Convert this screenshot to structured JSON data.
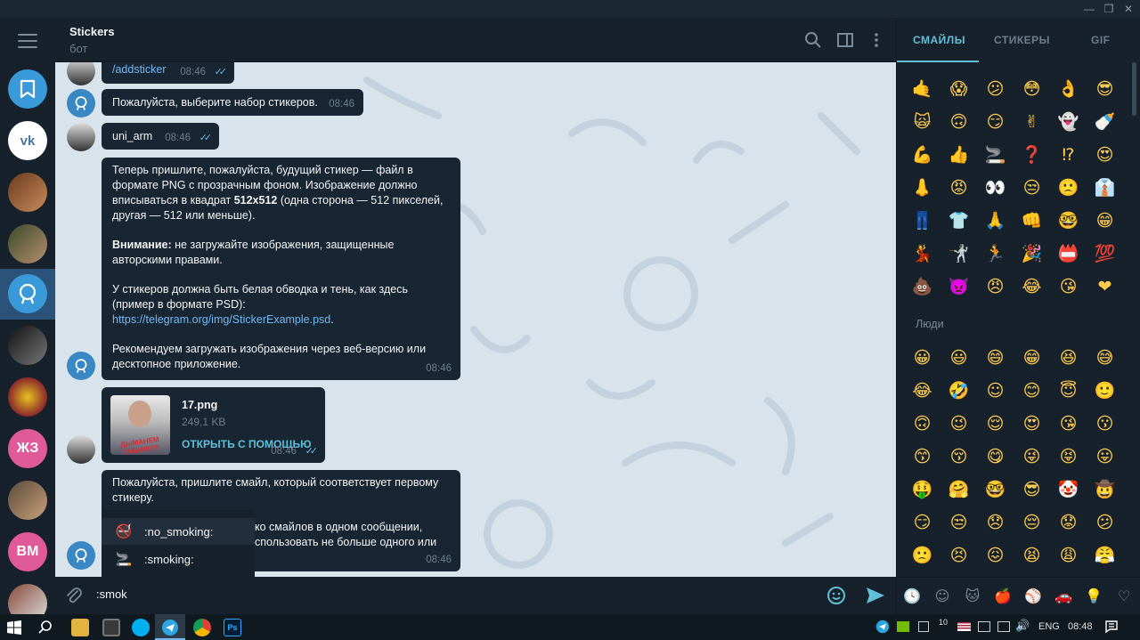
{
  "window": {
    "minimize": "—",
    "restore": "❐",
    "close": "✕"
  },
  "header": {
    "title": "Stickers",
    "subtitle": "бот"
  },
  "rail": {
    "initials_1": "ЖЗ",
    "initials_2": "ВМ"
  },
  "messages": {
    "m1_text": "/addsticker",
    "m1_time": "08:46",
    "m2_text": "Пожалуйста, выберите набор стикеров.",
    "m2_time": "08:46",
    "m3_text": "uni_arm",
    "m3_time": "08:46",
    "m4_p1_a": "Теперь пришлите, пожалуйста, будущий стикер — файл в",
    "m4_p1_b": "формате PNG с прозрачным фоном. Изображение должно",
    "m4_p1_c_pre": "вписываться в квадрат ",
    "m4_p1_c_bold": "512x512",
    "m4_p1_c_post": " (одна сторона — 512 пикселей,",
    "m4_p1_d": "другая — 512 или меньше).",
    "m4_p2_bold": "Внимание:",
    "m4_p2_a": " не загружайте изображения, защищенные",
    "m4_p2_b": "авторскими правами.",
    "m4_p3_a": "У стикеров должна быть белая обводка и тень, как здесь",
    "m4_p3_b": "(пример в формате PSD):",
    "m4_p3_link": "https://telegram.org/img/StickerExample.psd",
    "m4_p3_dot": ".",
    "m4_p4_a": "Рекомендуем загружать изображения через веб-версию или",
    "m4_p4_b": "десктопное приложение.",
    "m4_time": "08:46",
    "file_name": "17.png",
    "file_size": "249,1 KB",
    "file_action": "ОТКРЫТЬ С ПОМОЩЬЮ",
    "file_time": "08:46",
    "thumb_caption": "ДЫМАНЕМ ТАБАЧКУ?",
    "m6_a": "Пожалуйста, пришлите смайл, который соответствует первому",
    "m6_b": "стикеру.",
    "m6_c": "ко смайлов в одном сообщении,",
    "m6_d": "спользовать не больше одного или",
    "m6_time": "08:46"
  },
  "autocomplete": {
    "item1": ":no_smoking:",
    "item1_icon": "🚭",
    "item2": ":smoking:",
    "item2_icon": "🚬"
  },
  "input": {
    "value": ":smok"
  },
  "emoji_panel": {
    "tabs": [
      "СМАЙЛЫ",
      "СТИКЕРЫ",
      "GIF"
    ],
    "section_people": "Люди",
    "recent": [
      "🤙",
      "😱",
      "😕",
      "😳",
      "👌",
      "😎",
      "🙀",
      "🙃",
      "😏",
      "✌",
      "👻",
      "🍼",
      "💪",
      "👍",
      "🚬",
      "❓",
      "⁉",
      "😍",
      "👃",
      "😡",
      "👀",
      "😒",
      "🙁",
      "👔",
      "👖",
      "👕",
      "🙏",
      "👊",
      "🤓",
      "😁",
      "💃",
      "🤺",
      "🏃",
      "🎉",
      "📛",
      "💯",
      "💩",
      "👿",
      "😠",
      "😂",
      "😘",
      "❤"
    ],
    "people": [
      "😀",
      "😃",
      "😄",
      "😁",
      "😆",
      "😅",
      "😂",
      "🤣",
      "☺",
      "😊",
      "😇",
      "🙂",
      "🙃",
      "😉",
      "😌",
      "😍",
      "😘",
      "😗",
      "😙",
      "😚",
      "😋",
      "😜",
      "😝",
      "😛",
      "🤑",
      "🤗",
      "🤓",
      "😎",
      "🤡",
      "🤠",
      "😏",
      "😒",
      "😞",
      "😔",
      "😟",
      "😕",
      "🙁",
      "😣",
      "😖",
      "😫",
      "😩",
      "😤"
    ],
    "categories": [
      "🕓",
      "☺",
      "🐱",
      "🍎",
      "⚾",
      "🚗",
      "💡",
      "♡"
    ]
  },
  "taskbar": {
    "lang": "ENG",
    "time": "08:48",
    "notify": "10"
  },
  "colors": {
    "accent": "#5fc0d8",
    "bubble": "#182533",
    "chat_bg": "#d8e3ec",
    "active": "#2b5278"
  }
}
